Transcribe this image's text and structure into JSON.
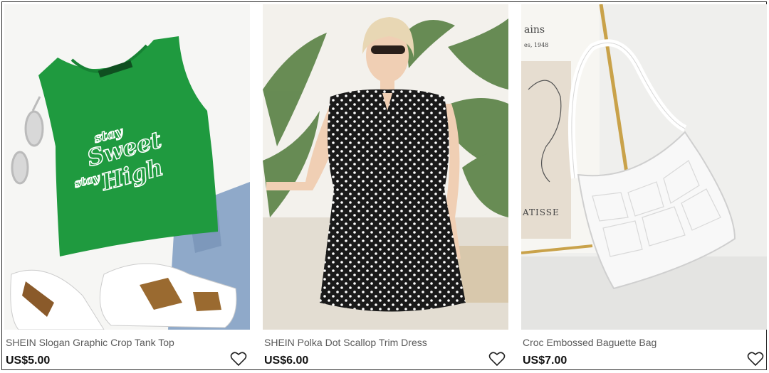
{
  "products": [
    {
      "title": "SHEIN Slogan Graphic Crop Tank Top",
      "price": "US$5.00",
      "image_icon": "green-crop-tank-top-image",
      "print_text": [
        "stay",
        "Sweet",
        "stay",
        "High"
      ]
    },
    {
      "title": "SHEIN Polka Dot Scallop Trim Dress",
      "price": "US$6.00",
      "image_icon": "polka-dot-dress-model-image"
    },
    {
      "title": "Croc Embossed Baguette Bag",
      "price": "US$7.00",
      "image_icon": "white-croc-bag-image",
      "poster_text": [
        "ains",
        "es, 1948",
        "ATISSE"
      ]
    }
  ],
  "wishlist_icon": "heart-outline-icon",
  "colors": {
    "title_text": "#5a5a5a",
    "price_text": "#111111",
    "tank_green": "#1f9a3f",
    "dress_black": "#1a1a1a"
  }
}
